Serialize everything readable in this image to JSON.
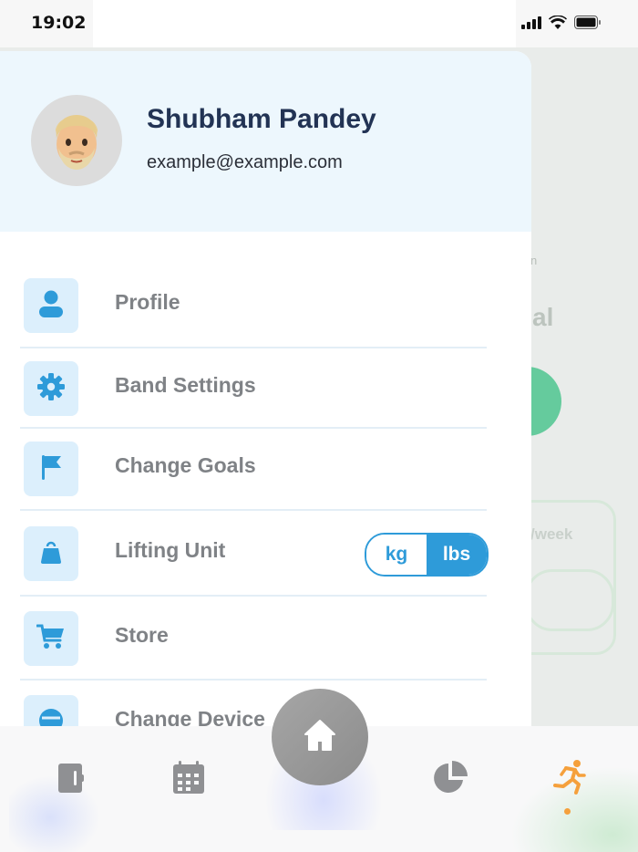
{
  "status_bar": {
    "time": "19:02"
  },
  "user": {
    "name": "Shubham Pandey",
    "email": "example@example.com"
  },
  "menu": {
    "items": [
      {
        "label": "Profile",
        "icon": "user-icon"
      },
      {
        "label": "Band Settings",
        "icon": "gear-icon"
      },
      {
        "label": "Change Goals",
        "icon": "flag-icon"
      },
      {
        "label": "Lifting Unit",
        "icon": "weight-icon"
      },
      {
        "label": "Store",
        "icon": "cart-icon"
      },
      {
        "label": "Change Device",
        "icon": "device-icon"
      }
    ]
  },
  "lifting_unit": {
    "options": [
      "kg",
      "lbs"
    ],
    "selected": "lbs"
  },
  "background": {
    "partial_text": "al",
    "partial_small": "n",
    "partial_week": "/week"
  },
  "bottom_nav": {
    "items": [
      "journal-icon",
      "calendar-icon",
      "home-icon",
      "pie-chart-icon",
      "running-icon"
    ],
    "active": "running-icon"
  },
  "colors": {
    "accent": "#2e9bd9",
    "active_tab": "#f5a03c",
    "name": "#223354"
  }
}
